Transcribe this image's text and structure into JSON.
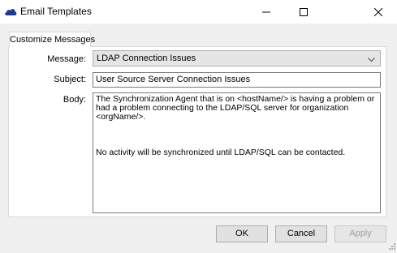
{
  "window": {
    "title": "Email Templates",
    "icon": "cloud-icon",
    "controls": [
      "minimize",
      "maximize",
      "close"
    ]
  },
  "tabs": [
    {
      "label": "Customize Messages",
      "selected": true
    }
  ],
  "form": {
    "message_label": "Message:",
    "message_value": "LDAP Connection Issues",
    "subject_label": "Subject:",
    "subject_value": "User Source Server Connection Issues",
    "body_label": "Body:",
    "body_para1": "The Synchronization Agent that is on <hostName/> is having a problem or had a problem connecting to the LDAP/SQL server for organization <orgName/>.",
    "body_para2": "No activity will be synchronized until LDAP/SQL can be contacted."
  },
  "buttons": {
    "ok": "OK",
    "cancel": "Cancel",
    "apply": "Apply"
  },
  "colors": {
    "window_bg": "#f0f0f0",
    "app_icon": "#1f3a93",
    "disabled_text": "#a0a0a0"
  }
}
